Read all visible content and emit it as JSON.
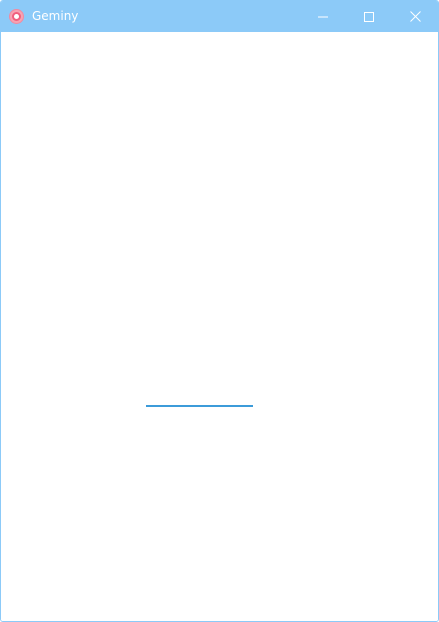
{
  "window": {
    "title": "Geminy",
    "accent_color": "#8ccaf8"
  },
  "titlebar": {
    "app_icon": "app-logo-icon",
    "controls": {
      "minimize_icon": "minimize-icon",
      "maximize_icon": "maximize-icon",
      "close_icon": "close-icon"
    }
  },
  "loading": {
    "indicator": "progress-bar",
    "color": "#3c9bd9",
    "progress": 1.0
  }
}
